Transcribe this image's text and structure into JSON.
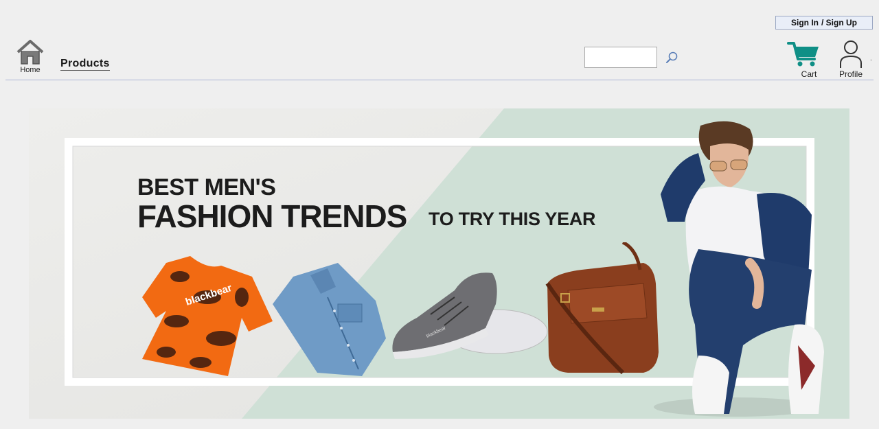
{
  "header": {
    "signin_label": "Sign In",
    "signup_label": "/ Sign Up",
    "home_label": "Home",
    "products_label": "Products",
    "search": {
      "value": "",
      "placeholder": ""
    },
    "cart_label": "Cart",
    "profile_label": "Profile",
    "trailing_mark": "."
  },
  "banner": {
    "line1": "BEST MEN'S",
    "line2": "FASHION TRENDS",
    "line3": "TO TRY THIS YEAR",
    "tshirt_brand": "blackbear",
    "shoe_brand": "blackbear"
  },
  "colors": {
    "page_bg": "#efefef",
    "cart_icon": "#0f8f86",
    "banner_mint": "#cfe0d6",
    "tshirt_orange": "#f26a12",
    "bag_brown": "#8a3e1e"
  },
  "icons": {
    "home": "home-icon",
    "search": "search-icon",
    "cart": "cart-icon",
    "profile": "user-icon"
  }
}
